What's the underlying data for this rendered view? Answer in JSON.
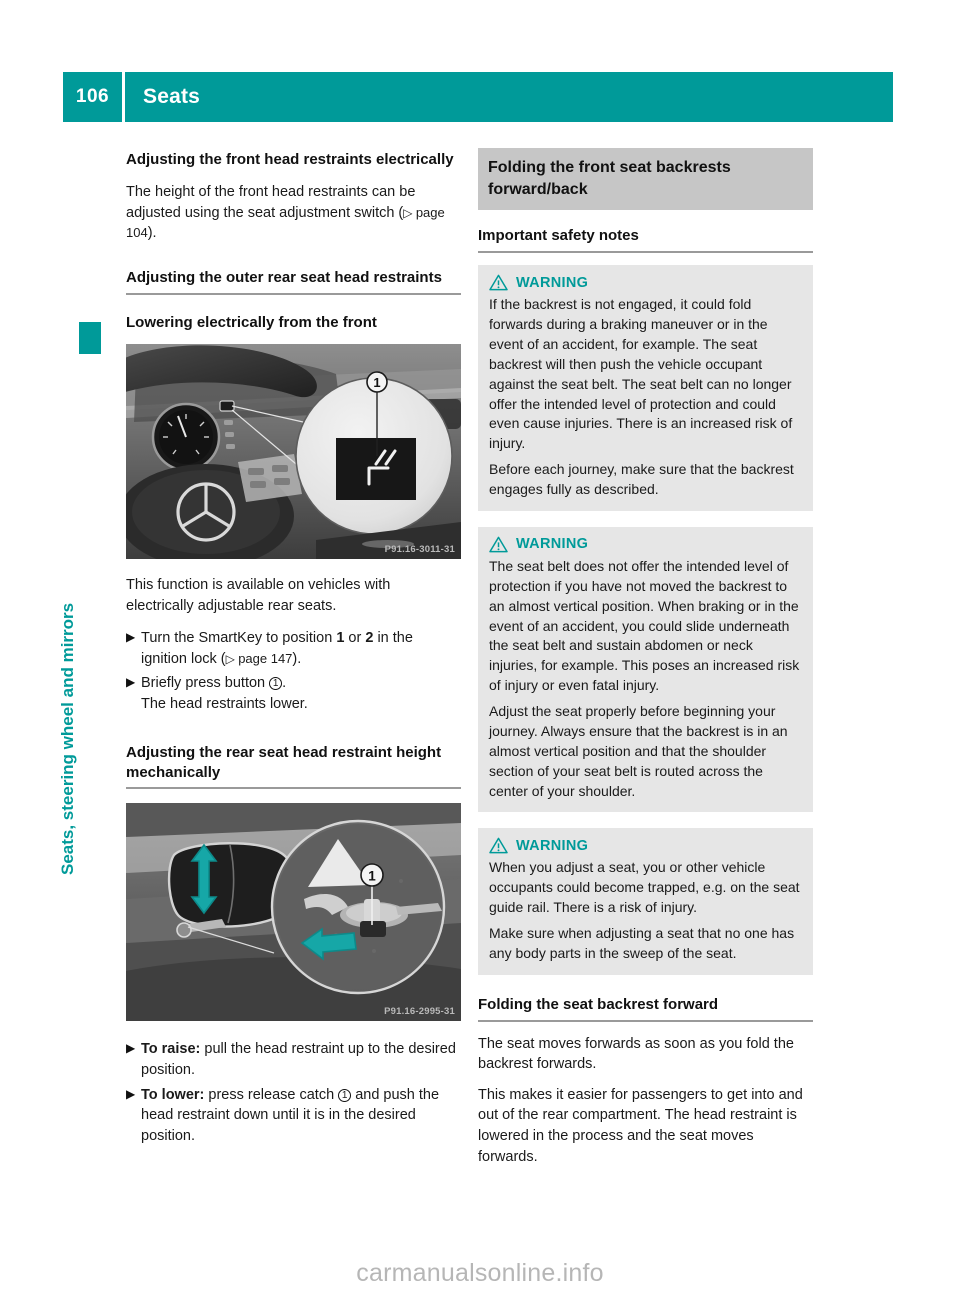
{
  "header": {
    "page_number": "106",
    "title": "Seats"
  },
  "side_tab": {
    "label": "Seats, steering wheel and mirrors",
    "color": "#009a99"
  },
  "left_column": {
    "heading_1": "Adjusting the front head restraints electrically",
    "para_1_prefix": "The height of the front head restraints can be adjusted using the seat adjustment switch (",
    "para_1_pageref": "page 104",
    "para_1_suffix": ").",
    "heading_2": "Adjusting the outer rear seat head restraints",
    "heading_3": "Lowering electrically from the front",
    "figure_1_code": "P91.16-3011-31",
    "para_2": "This function is available on vehicles with electrically adjustable rear seats.",
    "step_1_a": "Turn the SmartKey to position ",
    "step_1_bold_1": "1",
    "step_1_mid": " or ",
    "step_1_bold_2": "2",
    "step_1_b": " in the ignition lock (",
    "step_1_pageref": "page 147",
    "step_1_c": ").",
    "step_2_a": "Briefly press button ",
    "step_2_circ": "1",
    "step_2_b": ".",
    "step_2_sub": "The head restraints lower.",
    "heading_4": "Adjusting the rear seat head restraint height mechanically",
    "figure_2_code": "P91.16-2995-31",
    "step_3_bold": "To raise:",
    "step_3_text": " pull the head restraint up to the desired position.",
    "step_4_bold": "To lower:",
    "step_4_text_a": " press release catch ",
    "step_4_circ": "1",
    "step_4_text_b": " and push the head restraint down until it is in the desired position."
  },
  "right_column": {
    "section_title": "Folding the front seat backrests forward/back",
    "subheading_1": "Important safety notes",
    "warnings": [
      {
        "label": "WARNING",
        "paragraphs": [
          "If the backrest is not engaged, it could fold forwards during a braking maneuver or in the event of an accident, for example. The seat backrest will then push the vehicle occupant against the seat belt. The seat belt can no longer offer the intended level of protection and could even cause injuries. There is an increased risk of injury.",
          "Before each journey, make sure that the backrest engages fully as described."
        ]
      },
      {
        "label": "WARNING",
        "paragraphs": [
          "The seat belt does not offer the intended level of protection if you have not moved the backrest to an almost vertical position. When braking or in the event of an accident, you could slide underneath the seat belt and sustain abdomen or neck injuries, for example. This poses an increased risk of injury or even fatal injury.",
          "Adjust the seat properly before beginning your journey. Always ensure that the backrest is in an almost vertical position and that the shoulder section of your seat belt is routed across the center of your shoulder."
        ]
      },
      {
        "label": "WARNING",
        "paragraphs": [
          "When you adjust a seat, you or other vehicle occupants could become trapped, e.g. on the seat guide rail. There is a risk of injury.",
          "Make sure when adjusting a seat that no one has any body parts in the sweep of the seat."
        ]
      }
    ],
    "subheading_2": "Folding the seat backrest forward",
    "para_1": "The seat moves forwards as soon as you fold the backrest forwards.",
    "para_2": "This makes it easier for passengers to get into and out of the rear compartment. The head restraint is lowered in the process and the seat moves forwards."
  },
  "footer": {
    "watermark": "carmanualsonline.info"
  },
  "colors": {
    "teal": "#009a99",
    "warning_bg": "#e6e6e6",
    "section_header_bg": "#c6c6c6"
  }
}
